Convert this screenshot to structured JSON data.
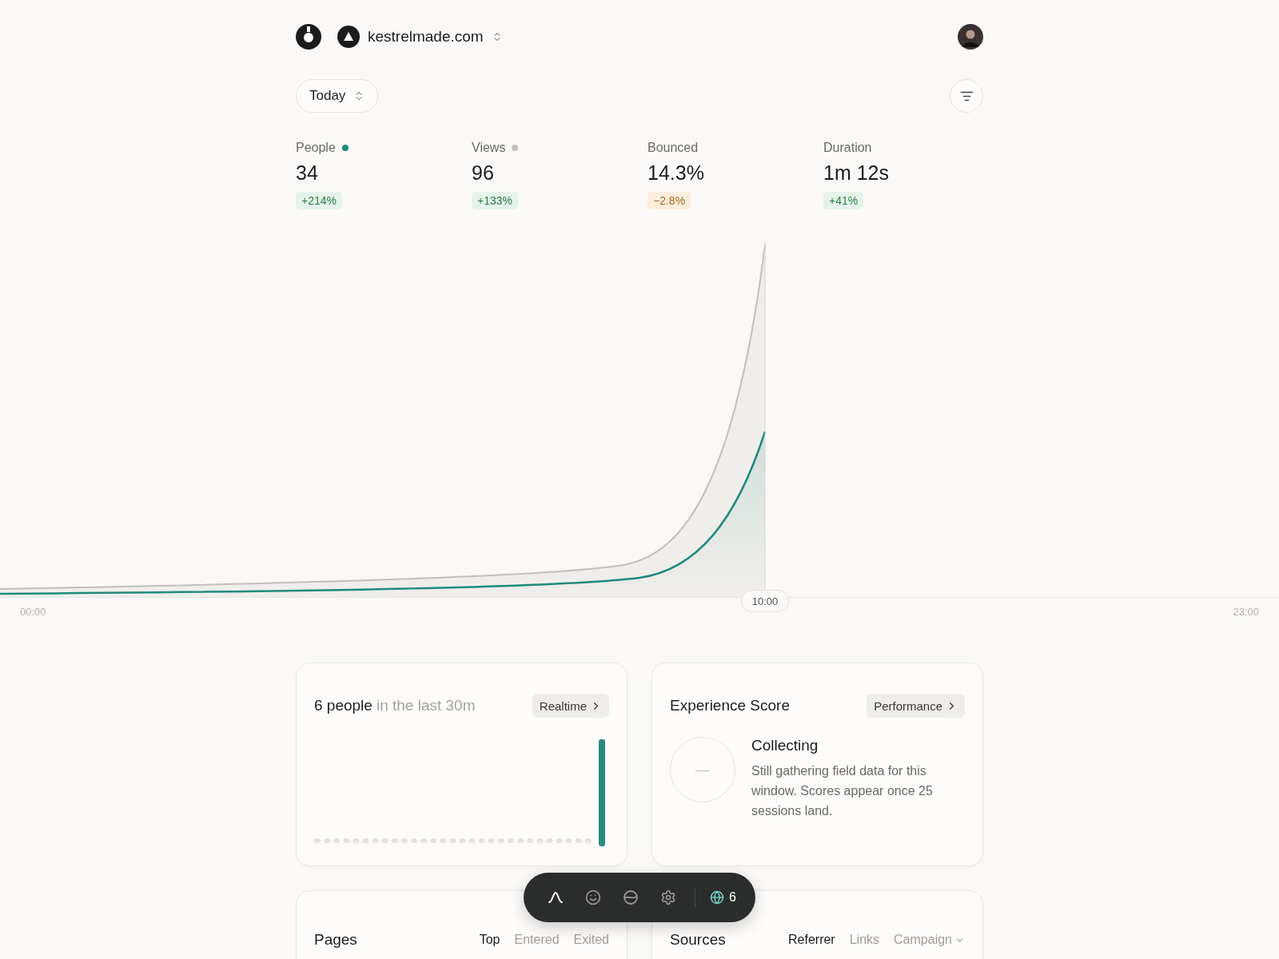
{
  "header": {
    "site": "kestrelmade.com"
  },
  "period": {
    "label": "Today"
  },
  "stats": [
    {
      "label": "People",
      "value": "34",
      "change": "+214%",
      "negative": false,
      "color": "#1f8a7e"
    },
    {
      "label": "Views",
      "value": "96",
      "change": "+133%",
      "negative": false,
      "color": "#c4c2bf"
    },
    {
      "label": "Bounced",
      "value": "14.3%",
      "change": "−2.8%",
      "negative": true
    },
    {
      "label": "Duration",
      "value": "1m 12s",
      "change": "+41%",
      "negative": false
    }
  ],
  "timeline": {
    "start": "00:00",
    "now": "10:00",
    "end": "23:00"
  },
  "realtime": {
    "count": "6 people",
    "caption": "in the last 30m",
    "link": "Realtime"
  },
  "experience": {
    "title": "Experience Score",
    "link": "Performance",
    "score": "—",
    "status": "Collecting",
    "description": "Still gathering field data for this window. Scores appear once 25 sessions land."
  },
  "pages": {
    "title": "Pages",
    "tabs": [
      {
        "label": "Top",
        "selected": true
      },
      {
        "label": "Entered",
        "selected": false
      },
      {
        "label": "Exited",
        "selected": false
      }
    ]
  },
  "sources": {
    "title": "Sources",
    "tabs": [
      {
        "label": "Referrer",
        "selected": true,
        "kind": "plain"
      },
      {
        "label": "Links",
        "selected": false,
        "kind": "plain"
      },
      {
        "label": "Campaign",
        "selected": false,
        "kind": "dropdown"
      }
    ]
  },
  "toolbar": {
    "items": [
      {
        "kind": "chart",
        "selected": true
      },
      {
        "kind": "smile",
        "selected": false
      },
      {
        "kind": "wave",
        "selected": false
      },
      {
        "kind": "settings",
        "selected": false
      }
    ],
    "online": "6"
  }
}
